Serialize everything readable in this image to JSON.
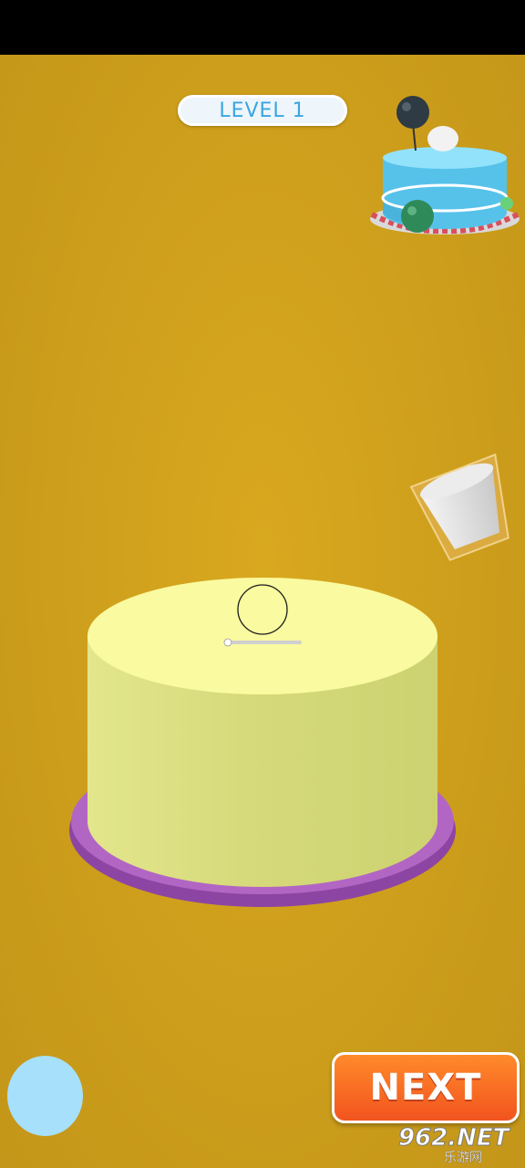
{
  "hud": {
    "level_label": "LEVEL 1"
  },
  "controls": {
    "next_label": "NEXT"
  },
  "watermark": {
    "main": "962.NET",
    "sub": "乐游网"
  },
  "colors": {
    "background": "#d4a31e",
    "cake_top": "#fafaa0",
    "cake_side": "#d9dd7e",
    "plate": "#b266c4",
    "preview_cake": "#56c2ea",
    "next_button": "#f7662a",
    "touch_button": "#a6e0fb"
  },
  "icons": {
    "preview": "target-cake-icon",
    "cup": "cream-cup-icon",
    "cursor": "aim-circle-icon"
  }
}
